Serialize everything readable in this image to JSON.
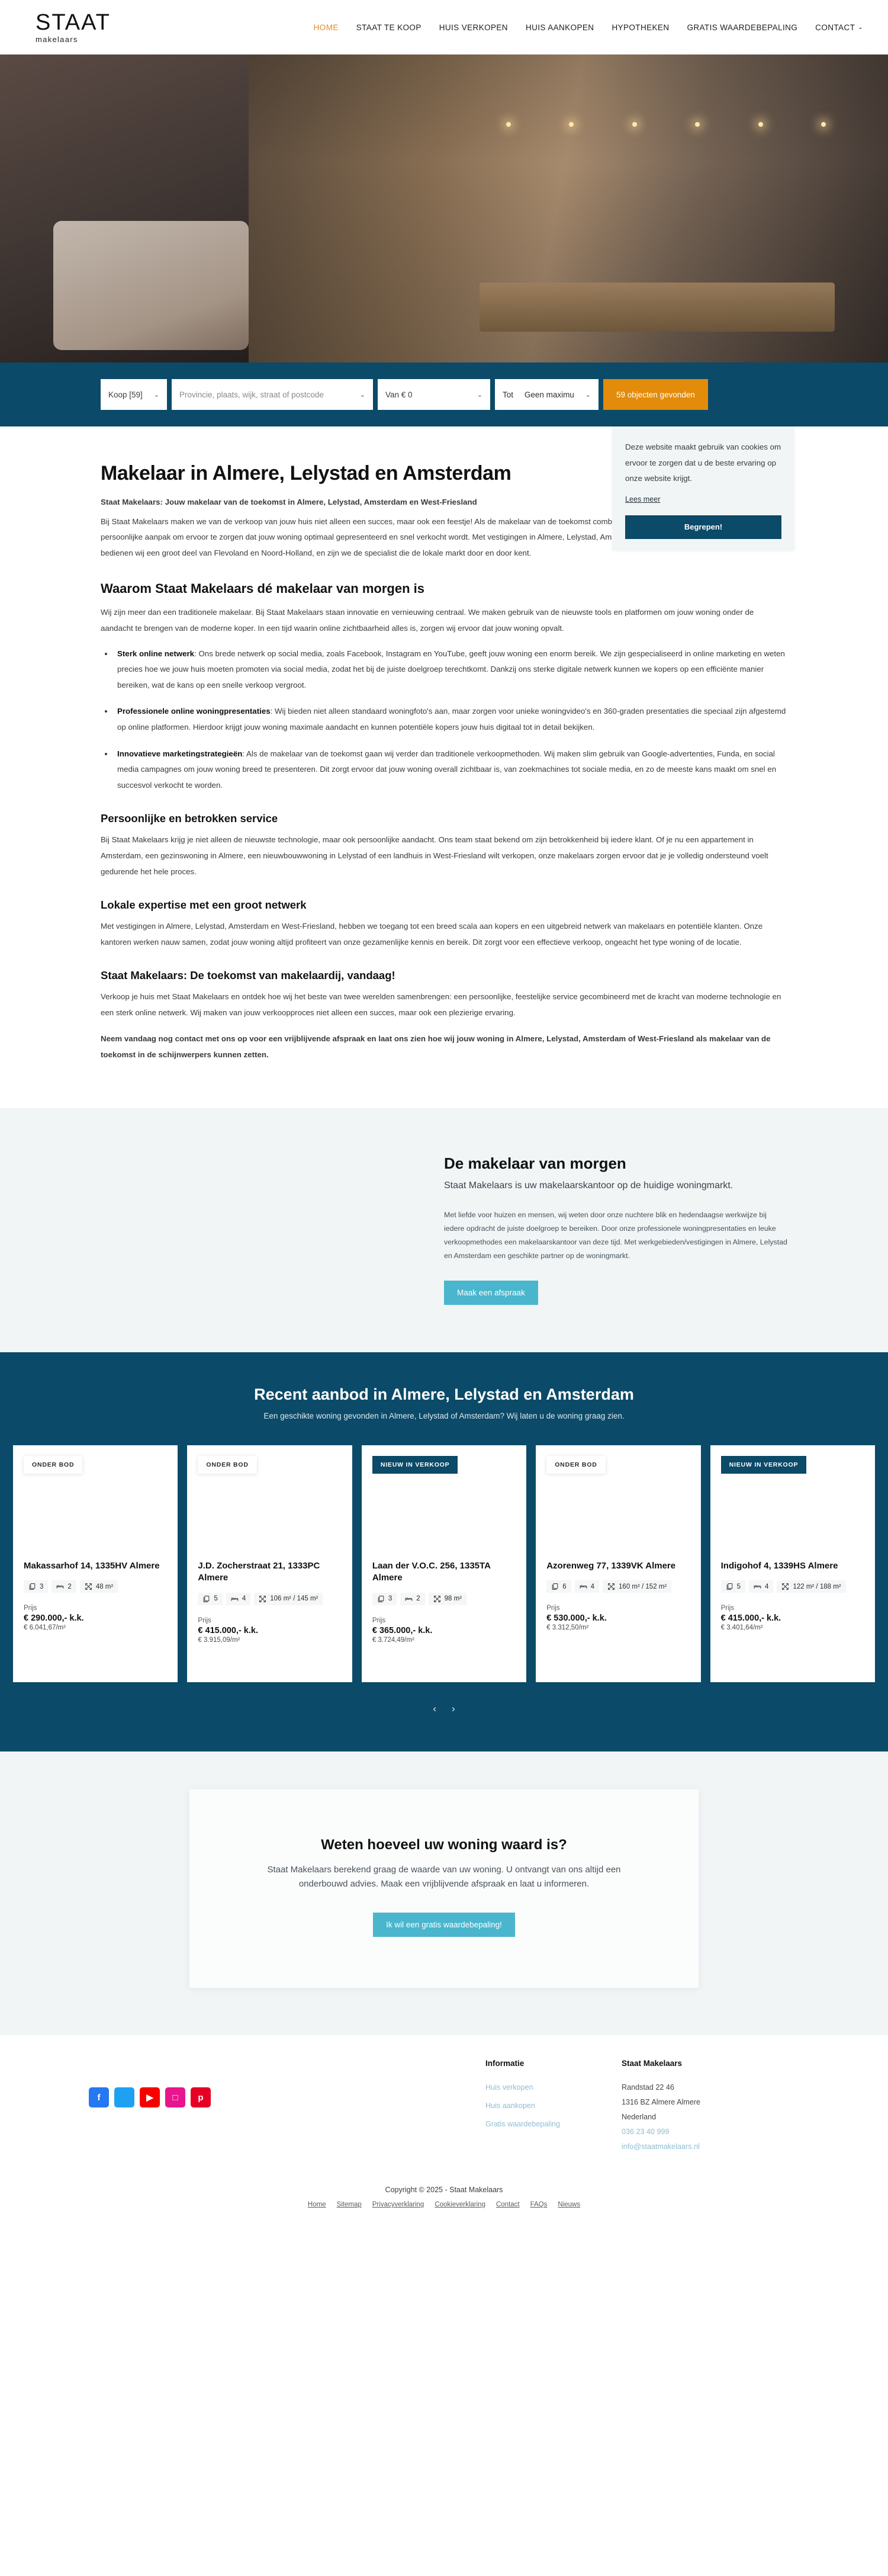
{
  "brand": {
    "logo_word": "STAAT",
    "logo_sub": "makelaars"
  },
  "nav": {
    "items": [
      {
        "label": "HOME",
        "active": true
      },
      {
        "label": "STAAT TE KOOP",
        "active": false
      },
      {
        "label": "HUIS VERKOPEN",
        "active": false
      },
      {
        "label": "HUIS AANKOPEN",
        "active": false
      },
      {
        "label": "HYPOTHEKEN",
        "active": false
      },
      {
        "label": "GRATIS WAARDEBEPALING",
        "active": false
      },
      {
        "label": "CONTACT",
        "active": false,
        "caret": "⌄"
      }
    ]
  },
  "search": {
    "type_value": "Koop [59]",
    "place_placeholder": "Provincie, plaats, wijk, straat of postcode",
    "min_label": "Van € 0",
    "max_label": "Tot",
    "max_value": "Geen maximu",
    "results_button": "59 objecten gevonden",
    "caret": "⌄"
  },
  "cookie": {
    "text": "Deze website maakt gebruik van cookies om ervoor te zorgen dat u de beste ervaring op onze website krijgt.",
    "link": "Lees meer",
    "button": "Begrepen!"
  },
  "article": {
    "title": "Makelaar in Almere, Lelystad en Amsterdam",
    "lede": "Staat Makelaars: Jouw makelaar van de toekomst in Almere, Lelystad, Amsterdam en West-Friesland",
    "intro_p1": "Bij Staat Makelaars maken we van de verkoop van jouw huis niet alleen een succes, maar ook een feestje! Als de makelaar van de toekomst combineren wij moderne technologieën en een persoonlijke aanpak om ervoor te zorgen dat jouw woning optimaal gepresenteerd en snel verkocht wordt. Met vestigingen in Almere, Lelystad, Amsterdam en West-Friesland (Enkhuizen-Hoorn) bedienen wij een groot deel van Flevoland en Noord-Holland, en zijn we de specialist die de lokale markt door en door kent.",
    "h2_waarom": "Waarom Staat Makelaars dé makelaar van morgen is",
    "waarom_p": "Wij zijn meer dan een traditionele makelaar. Bij Staat Makelaars staan innovatie en vernieuwing centraal. We maken gebruik van de nieuwste tools en platformen om jouw woning onder de aandacht te brengen van de moderne koper. In een tijd waarin online zichtbaarheid alles is, zorgen wij ervoor dat jouw woning opvalt.",
    "bullets": [
      {
        "title": "Sterk online netwerk",
        "text": ": Ons brede netwerk op social media, zoals Facebook, Instagram en YouTube, geeft jouw woning een enorm bereik. We zijn gespecialiseerd in online marketing en weten precies hoe we jouw huis moeten promoten via social media, zodat het bij de juiste doelgroep terechtkomt. Dankzij ons sterke digitale netwerk kunnen we kopers op een efficiënte manier bereiken, wat de kans op een snelle verkoop vergroot."
      },
      {
        "title": "Professionele online woningpresentaties",
        "text": ": Wij bieden niet alleen standaard woningfoto's aan, maar zorgen voor unieke woningvideo's en 360-graden presentaties die speciaal zijn afgestemd op online platformen. Hierdoor krijgt jouw woning maximale aandacht en kunnen potentiële kopers jouw huis digitaal tot in detail bekijken."
      },
      {
        "title": "Innovatieve marketingstrategieën",
        "text": ": Als de makelaar van de toekomst gaan wij verder dan traditionele verkoopmethoden. Wij maken slim gebruik van Google-advertenties, Funda, en social media campagnes om jouw woning breed te presenteren. Dit zorgt ervoor dat jouw woning overall zichtbaar is, van zoekmachines tot sociale media, en zo de meeste kans maakt om snel en succesvol verkocht te worden."
      }
    ],
    "h3_persoonlijk": "Persoonlijke en betrokken service",
    "persoonlijk_p": "Bij Staat Makelaars krijg je niet alleen de nieuwste technologie, maar ook persoonlijke aandacht. Ons team staat bekend om zijn betrokkenheid bij iedere klant. Of je nu een appartement in Amsterdam, een gezinswoning in Almere, een nieuwbouwwoning in Lelystad of een landhuis in West-Friesland wilt verkopen, onze makelaars zorgen ervoor dat je je volledig ondersteund voelt gedurende het hele proces.",
    "h3_lokaal": "Lokale expertise met een groot netwerk",
    "lokaal_p": "Met vestigingen in Almere, Lelystad, Amsterdam en West-Friesland, hebben we toegang tot een breed scala aan kopers en een uitgebreid netwerk van makelaars en potentiële klanten. Onze kantoren werken nauw samen, zodat jouw woning altijd profiteert van onze gezamenlijke kennis en bereik. Dit zorgt voor een effectieve verkoop, ongeacht het type woning of de locatie.",
    "h3_toekomst": "Staat Makelaars: De toekomst van makelaardij, vandaag!",
    "toekomst_p": "Verkoop je huis met Staat Makelaars en ontdek hoe wij het beste van twee werelden samenbrengen: een persoonlijke, feestelijke service gecombineerd met de kracht van moderne technologie en een sterk online netwerk. Wij maken van jouw verkoopproces niet alleen een succes, maar ook een plezierige ervaring.",
    "closing": "Neem vandaag nog contact met ons op voor een vrijblijvende afspraak en laat ons zien hoe wij jouw woning in Almere, Lelystad, Amsterdam of West-Friesland als makelaar van de toekomst in de schijnwerpers kunnen zetten."
  },
  "tomorrow": {
    "title": "De makelaar van morgen",
    "subtitle": "Staat Makelaars is uw makelaarskantoor op de huidige woningmarkt.",
    "body": "Met liefde voor huizen en mensen, wij weten door onze nuchtere blik en hedendaagse werkwijze bij iedere opdracht de juiste doelgroep te bereiken. Door onze professionele woningpresentaties en leuke verkoopmethodes een makelaarskantoor van deze tijd. Met werkgebieden/vestigingen in Almere, Lelystad en Amsterdam een geschikte partner op de woningmarkt.",
    "button": "Maak een afspraak"
  },
  "listings": {
    "title": "Recent aanbod in Almere, Lelystad en Amsterdam",
    "subtitle": "Een geschikte woning gevonden in Almere, Lelystad of Amsterdam? Wij laten u de woning graag zien.",
    "price_label": "Prijs",
    "prev": "‹",
    "next": "›",
    "cards": [
      {
        "badge": "ONDER BOD",
        "badge_style": "onder-bod",
        "title": "Makassarhof 14, 1335HV Almere",
        "specs": [
          {
            "icon": "rooms-icon",
            "value": "3"
          },
          {
            "icon": "bed-icon",
            "value": "2"
          },
          {
            "icon": "area-icon",
            "value": "48 m²"
          }
        ],
        "price": "€ 290.000,- k.k.",
        "price_sqm": "€ 6.041,67/m²"
      },
      {
        "badge": "ONDER BOD",
        "badge_style": "onder-bod",
        "title": "J.D. Zocherstraat 21, 1333PC Almere",
        "specs": [
          {
            "icon": "rooms-icon",
            "value": "5"
          },
          {
            "icon": "bed-icon",
            "value": "4"
          },
          {
            "icon": "area-icon",
            "value": "106 m² / 145 m²"
          }
        ],
        "price": "€ 415.000,- k.k.",
        "price_sqm": "€ 3.915,09/m²"
      },
      {
        "badge": "NIEUW IN VERKOOP",
        "badge_style": "nieuw",
        "title": "Laan der V.O.C. 256, 1335TA Almere",
        "specs": [
          {
            "icon": "rooms-icon",
            "value": "3"
          },
          {
            "icon": "bed-icon",
            "value": "2"
          },
          {
            "icon": "area-icon",
            "value": "98 m²"
          }
        ],
        "price": "€ 365.000,- k.k.",
        "price_sqm": "€ 3.724,49/m²"
      },
      {
        "badge": "ONDER BOD",
        "badge_style": "onder-bod",
        "title": "Azorenweg 77, 1339VK Almere",
        "specs": [
          {
            "icon": "rooms-icon",
            "value": "6"
          },
          {
            "icon": "bed-icon",
            "value": "4"
          },
          {
            "icon": "area-icon",
            "value": "160 m² / 152 m²"
          }
        ],
        "price": "€ 530.000,- k.k.",
        "price_sqm": "€ 3.312,50/m²"
      },
      {
        "badge": "NIEUW IN VERKOOP",
        "badge_style": "nieuw",
        "title": "Indigohof 4, 1339HS Almere",
        "specs": [
          {
            "icon": "rooms-icon",
            "value": "5"
          },
          {
            "icon": "bed-icon",
            "value": "4"
          },
          {
            "icon": "area-icon",
            "value": "122 m² / 188 m²"
          }
        ],
        "price": "€ 415.000,- k.k.",
        "price_sqm": "€ 3.401,64/m²"
      }
    ]
  },
  "valuation": {
    "title": "Weten hoeveel uw woning waard is?",
    "text": "Staat Makelaars berekend graag de waarde van uw woning. U ontvangt van ons altijd een onderbouwd advies. Maak een vrijblijvende afspraak en laat u informeren.",
    "button": "Ik wil een gratis waardebepaling!"
  },
  "footer": {
    "socials": [
      {
        "name": "facebook-icon",
        "glyph": "f",
        "cls": "s-fb"
      },
      {
        "name": "twitter-icon",
        "glyph": "",
        "cls": "s-tw"
      },
      {
        "name": "youtube-icon",
        "glyph": "▶",
        "cls": "s-yt"
      },
      {
        "name": "instagram-icon",
        "glyph": "□",
        "cls": "s-ig"
      },
      {
        "name": "pinterest-icon",
        "glyph": "р",
        "cls": "s-pi"
      }
    ],
    "info_heading": "Informatie",
    "info_links": [
      "Huis verkopen",
      "Huis aankopen",
      "Gratis waardebepaling"
    ],
    "contact_heading": "Staat Makelaars",
    "address_lines": [
      "Randstad 22 46",
      "1316 BZ Almere Almere",
      "Nederland"
    ],
    "phone": "036 23 40 999",
    "email": "info@staatmakelaars.nl",
    "copyright": "Copyright © 2025 - Staat Makelaars",
    "legal_links": [
      "Home",
      "Sitemap",
      "Privacyverklaring",
      "Cookieverklaring",
      "Contact",
      "FAQs",
      "Nieuws"
    ]
  },
  "colors": {
    "brand_blue": "#0b4a68",
    "accent_orange": "#e38b0a",
    "nav_active": "#e08b33",
    "teal": "#49b6cd"
  }
}
